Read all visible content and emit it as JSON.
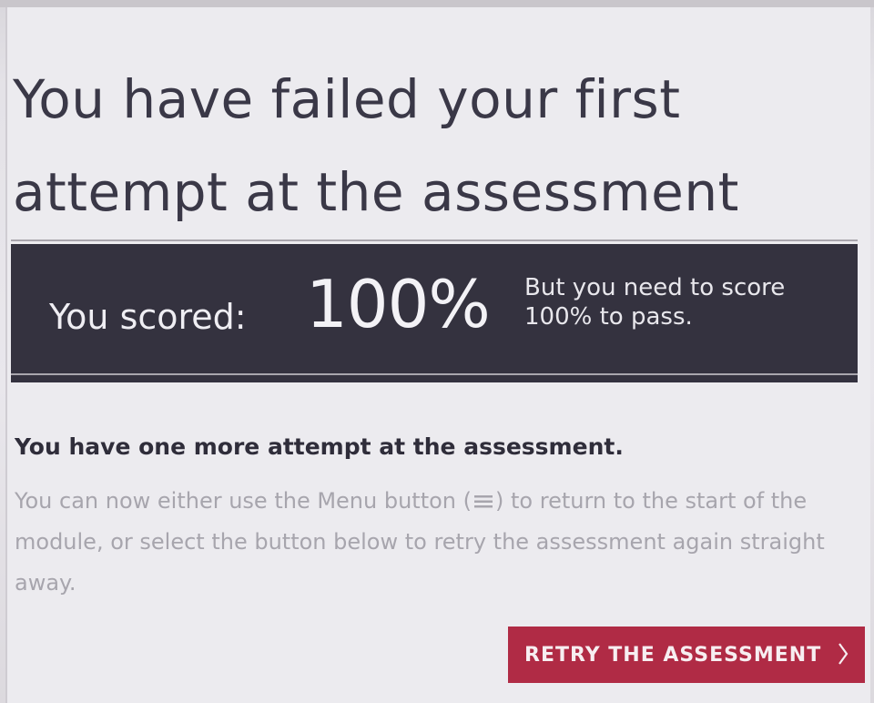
{
  "heading": {
    "title": "You have failed your first attempt at the assessment"
  },
  "score": {
    "label": "You scored:",
    "value": "100%",
    "note": "But you need to score 100% to pass."
  },
  "attempts": {
    "message": "You have one more attempt at the assessment."
  },
  "instructions": {
    "part1": "You can now either use the Menu button (",
    "part2": ") to return to the start of the module, or select the button below to retry the assessment again straight away.",
    "menu_icon": "menu-icon"
  },
  "actions": {
    "retry_label": "RETRY THE ASSESSMENT",
    "retry_icon": "chevron-right-icon"
  },
  "colors": {
    "score_bar": "#34323f",
    "retry_button": "#b02b45",
    "title_text": "#3a3847"
  }
}
